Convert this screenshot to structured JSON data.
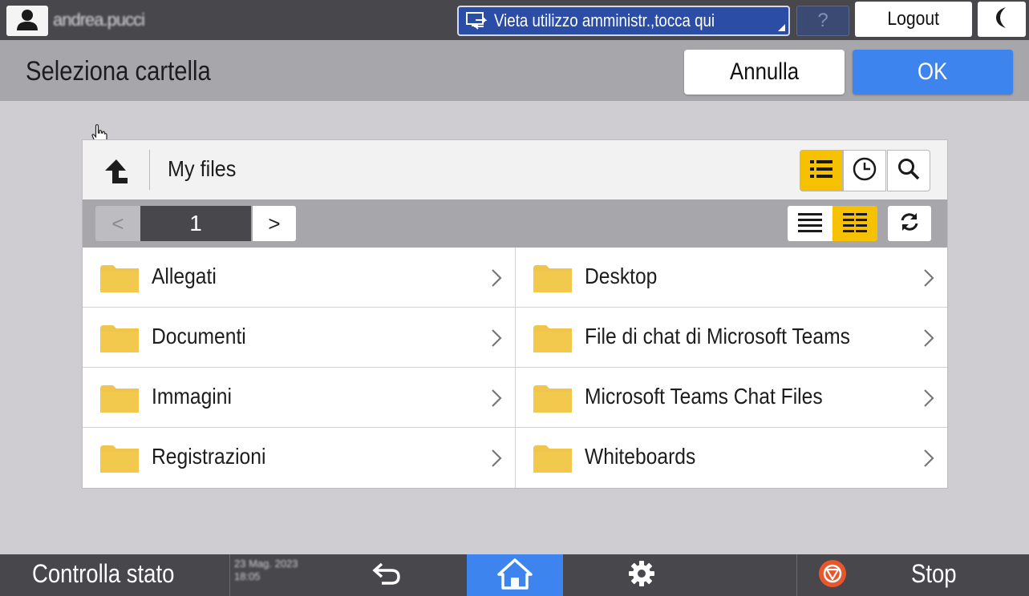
{
  "topbar": {
    "username": "andrea.pucci",
    "admin_notice": "Vieta utilizzo amministr.,tocca qui",
    "help_label": "?",
    "logout_label": "Logout"
  },
  "header": {
    "title": "Seleziona cartella",
    "cancel_label": "Annulla",
    "ok_label": "OK"
  },
  "browser": {
    "path": "My files",
    "pagination": {
      "prev_label": "<",
      "page": "1",
      "next_label": ">"
    },
    "folders": [
      {
        "name": "Allegati"
      },
      {
        "name": "Desktop"
      },
      {
        "name": "Documenti"
      },
      {
        "name": "File di chat di Microsoft Teams"
      },
      {
        "name": "Immagini"
      },
      {
        "name": "Microsoft Teams Chat Files"
      },
      {
        "name": "Registrazioni"
      },
      {
        "name": "Whiteboards"
      }
    ]
  },
  "bottombar": {
    "status_label": "Controlla stato",
    "date": "23 Mag. 2023",
    "time": "18:05",
    "stop_label": "Stop"
  },
  "colors": {
    "accent_blue": "#3e84ee",
    "selected_yellow": "#f5c100",
    "folder_yellow": "#f0c54c",
    "bar_dark": "#48474c"
  }
}
